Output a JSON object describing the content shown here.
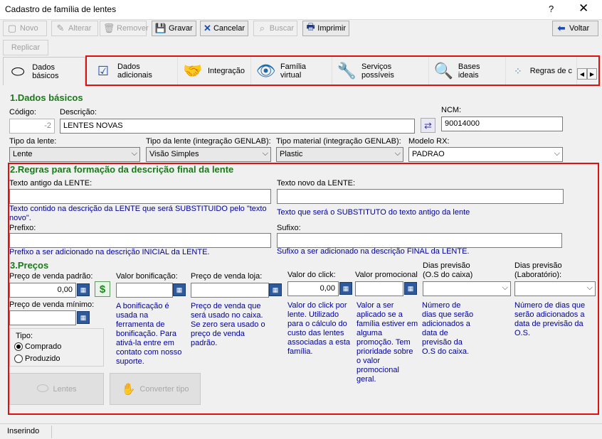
{
  "window": {
    "title": "Cadastro de família de lentes",
    "help": "?",
    "close": "✕"
  },
  "toolbar": {
    "novo": "Novo",
    "alterar": "Alterar",
    "remover": "Remover",
    "gravar": "Gravar",
    "cancelar": "Cancelar",
    "buscar": "Buscar",
    "imprimir": "Imprimir",
    "voltar": "Voltar",
    "replicar": "Replicar"
  },
  "tabs": [
    {
      "label": "Dados básicos",
      "icon": "lens-icon"
    },
    {
      "label": "Dados adicionais",
      "icon": "checklist-icon"
    },
    {
      "label": "Integração",
      "icon": "handshake-icon"
    },
    {
      "label": "Família virtual",
      "icon": "eye-icon"
    },
    {
      "label": "Serviços possíveis",
      "icon": "wrench-icon"
    },
    {
      "label": "Bases ideais",
      "icon": "magnifier-icon"
    },
    {
      "label": "Regras de c",
      "icon": "dots-icon"
    }
  ],
  "section1": {
    "title": "1.Dados básicos",
    "codigo_label": "Código:",
    "codigo_value": "-2",
    "descricao_label": "Descrição:",
    "descricao_value": "LENTES NOVAS",
    "ncm_label": "NCM:",
    "ncm_value": "90014000",
    "tipo_lente_label": "Tipo da lente:",
    "tipo_lente_value": "Lente",
    "tipo_lente_genlab_label": "Tipo da lente (integração GENLAB):",
    "tipo_lente_genlab_value": "Visão Simples",
    "tipo_material_label": "Tipo material (integração GENLAB):",
    "tipo_material_value": "Plastic",
    "modelo_rx_label": "Modelo RX:",
    "modelo_rx_value": "PADRAO"
  },
  "section2": {
    "title": "2.Regras para formação da descrição final da lente",
    "texto_antigo_label": "Texto antigo da LENTE:",
    "texto_antigo_hint": "Texto contido na descrição da LENTE que será SUBSTITUIDO pelo \"texto novo\".",
    "texto_novo_label": "Texto novo da LENTE:",
    "texto_novo_hint": "Texto que será o SUBSTITUTO do texto antigo da lente",
    "prefixo_label": "Prefixo:",
    "prefixo_hint": "Prefixo a ser adicionado na descrição INICIAL da LENTE.",
    "sufixo_label": "Sufixo:",
    "sufixo_hint": "Sufixo a ser adicionado na descrição FINAL da LENTE."
  },
  "section3": {
    "title": "3.Preços",
    "preco_padrao_label": "Preço de venda padrão:",
    "preco_padrao_value": "0,00",
    "bonificacao_label": "Valor bonificação:",
    "bonificacao_hint": "A bonificação é usada na ferramenta de bonificação. Para ativá-la entre em contato com nosso suporte.",
    "preco_loja_label": "Preço de venda loja:",
    "preco_loja_hint": "Preço de venda que será usado no caixa. Se zero sera usado o preço de venda padrão.",
    "click_label": "Valor do click:",
    "click_value": "0,00",
    "click_hint": "Valor do click por lente. Utilizado para o cálculo do custo das lentes associadas a esta família.",
    "promocional_label": "Valor promocional",
    "promocional_hint": "Valor a ser aplicado se a família estiver em alguma promoção. Tem prioridade sobre o valor promocional geral.",
    "dias_caixa_label1": "Dias previsão",
    "dias_caixa_label2": "(O.S do caixa)",
    "dias_caixa_hint": "Número de dias que serão adicionados a data de previsão da O.S do caixa.",
    "dias_lab_label1": "Dias previsão",
    "dias_lab_label2": "(Laboratório):",
    "dias_lab_hint": "Número de dias que serão adicionados a data de previsão da O.S.",
    "preco_minimo_label": "Preço de venda mínimo:",
    "tipo_label": "Tipo:",
    "comprado": "Comprado",
    "produzido": "Produzido",
    "lentes_button": "Lentes",
    "converter_button": "Converter tipo"
  },
  "status": {
    "text": "Inserindo"
  },
  "colors": {
    "section_title": "#1a7a1a",
    "hint": "#00009c",
    "highlight_border": "#e01010"
  }
}
